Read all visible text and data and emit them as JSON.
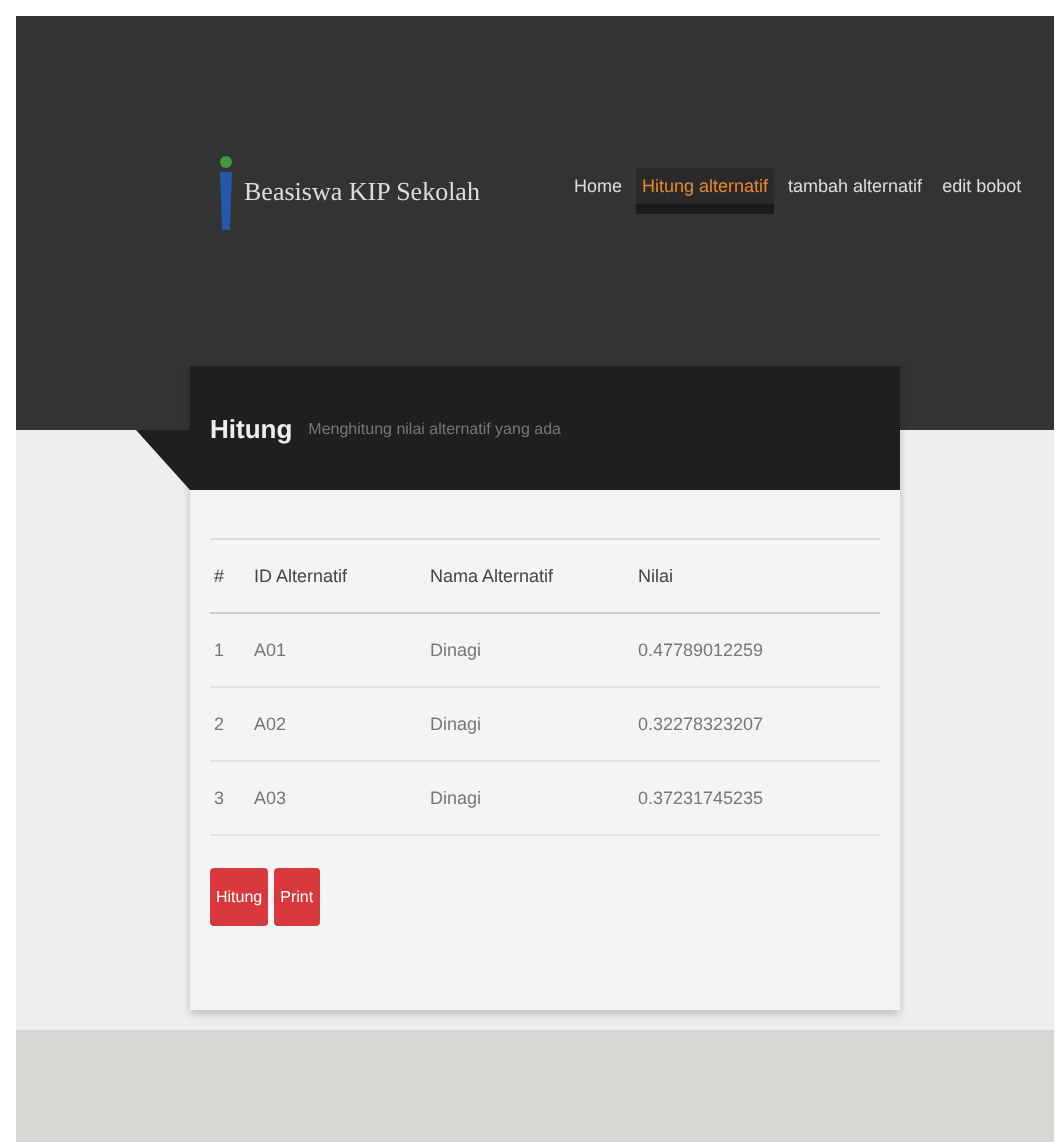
{
  "brand": "Beasiswa KIP Sekolah",
  "nav": [
    {
      "label": "Home",
      "selected": false
    },
    {
      "label": "Hitung alternatif",
      "selected": true
    },
    {
      "label": "tambah alternatif",
      "selected": false
    },
    {
      "label": "edit bobot",
      "selected": false
    }
  ],
  "panel": {
    "title": "Hitung",
    "subtitle": "Menghitung nilai alternatif yang ada"
  },
  "table": {
    "columns": [
      "#",
      "ID Alternatif",
      "Nama Alternatif",
      "Nilai"
    ],
    "rows": [
      [
        "1",
        "A01",
        "Dinagi",
        "0.47789012259"
      ],
      [
        "2",
        "A02",
        "Dinagi",
        "0.32278323207"
      ],
      [
        "3",
        "A03",
        "Dinagi",
        "0.37231745235"
      ]
    ]
  },
  "buttons": [
    "Hitung",
    "Print"
  ]
}
